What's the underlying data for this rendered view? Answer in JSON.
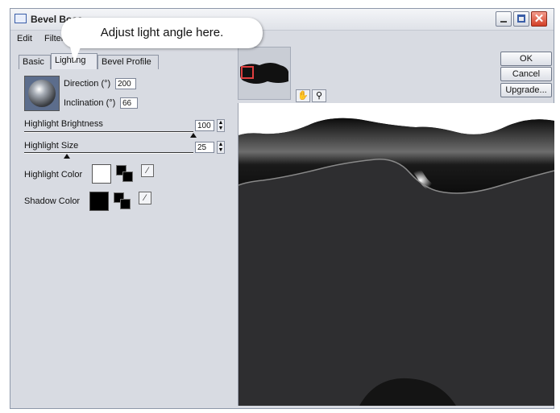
{
  "window": {
    "title": "Bevel Boss"
  },
  "menu": {
    "items": [
      "Edit",
      "Filter"
    ]
  },
  "tabs": [
    "Basic",
    "Lighting",
    "Bevel Profile"
  ],
  "lighting": {
    "direction_label": "Direction (°)",
    "direction_value": "200",
    "inclination_label": "Inclination (°)",
    "inclination_value": "66",
    "highlight_brightness_label": "Highlight Brightness",
    "highlight_brightness_value": "100",
    "highlight_brightness_level": 1.0,
    "highlight_size_label": "Highlight Size",
    "highlight_size_value": "25",
    "highlight_size_level": 0.25,
    "highlight_color_label": "Highlight Color",
    "highlight_color": "#ffffff",
    "shadow_color_label": "Shadow Color",
    "shadow_color": "#000000"
  },
  "buttons": {
    "ok": "OK",
    "cancel": "Cancel",
    "upgrade": "Upgrade..."
  },
  "tools": [
    "hand-icon",
    "zoom-icon"
  ],
  "callout": {
    "text": "Adjust  light angle here."
  }
}
